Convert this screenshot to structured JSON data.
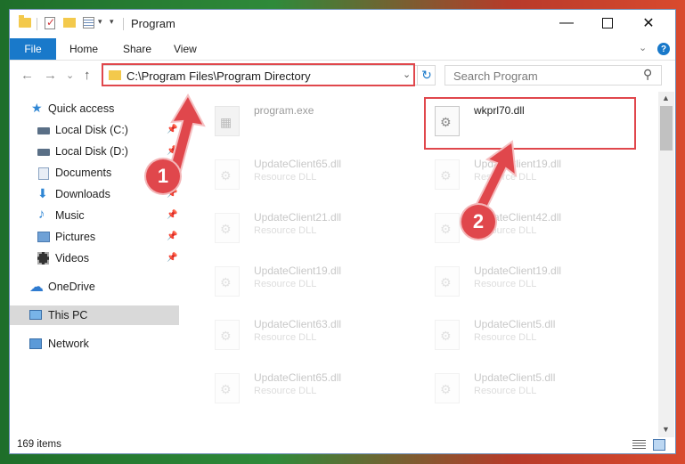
{
  "window": {
    "title": "Program",
    "minimize_glyph": "—",
    "close_glyph": "✕"
  },
  "ribbon": {
    "tabs": [
      "File",
      "Home",
      "Share",
      "View"
    ],
    "help_glyph": "?"
  },
  "navigation": {
    "back_glyph": "←",
    "forward_glyph": "→",
    "recent_glyph": "⌄",
    "up_glyph": "↑"
  },
  "address": {
    "path": "C:\\Program Files\\Program Directory",
    "drop_glyph": "⌄",
    "refresh_glyph": "↻"
  },
  "search": {
    "placeholder": "Search Program",
    "icon_glyph": "⚲"
  },
  "sidebar": {
    "items": [
      {
        "label": "Quick access",
        "icon": "star-icon",
        "pinned": false
      },
      {
        "label": "Local Disk (C:)",
        "icon": "drive-icon",
        "pinned": true
      },
      {
        "label": "Local Disk (D:)",
        "icon": "drive-icon",
        "pinned": true
      },
      {
        "label": "Documents",
        "icon": "documents-icon",
        "pinned": true
      },
      {
        "label": "Downloads",
        "icon": "downloads-icon",
        "pinned": true
      },
      {
        "label": "Music",
        "icon": "music-icon",
        "pinned": true
      },
      {
        "label": "Pictures",
        "icon": "pictures-icon",
        "pinned": true
      },
      {
        "label": "Videos",
        "icon": "videos-icon",
        "pinned": true
      },
      {
        "label": "OneDrive",
        "icon": "onedrive-icon",
        "pinned": false
      },
      {
        "label": "This PC",
        "icon": "this-pc-icon",
        "pinned": false,
        "selected": true
      },
      {
        "label": "Network",
        "icon": "network-icon",
        "pinned": false
      }
    ],
    "pin_glyph": "📌"
  },
  "files": [
    {
      "name": "program.exe",
      "type": "",
      "highlighted": false
    },
    {
      "name": "wkprl70.dll",
      "type": "",
      "highlighted": true
    },
    {
      "name": "UpdateClient65.dll",
      "type": "Resource DLL"
    },
    {
      "name": "UpdateClient19.dll",
      "type": "Resource DLL"
    },
    {
      "name": "UpdateClient21.dll",
      "type": "Resource DLL"
    },
    {
      "name": "UpdateClient42.dll",
      "type": "Resource DLL"
    },
    {
      "name": "UpdateClient19.dll",
      "type": "Resource DLL"
    },
    {
      "name": "UpdateClient19.dll",
      "type": "Resource DLL"
    },
    {
      "name": "UpdateClient63.dll",
      "type": "Resource DLL"
    },
    {
      "name": "UpdateClient5.dll",
      "type": "Resource DLL"
    },
    {
      "name": "UpdateClient65.dll",
      "type": "Resource DLL"
    },
    {
      "name": "UpdateClient5.dll",
      "type": "Resource DLL"
    }
  ],
  "status": {
    "item_count": "169 items"
  },
  "callouts": [
    "1",
    "2"
  ],
  "colors": {
    "accent": "#1979ca",
    "highlight": "#e0474c"
  }
}
